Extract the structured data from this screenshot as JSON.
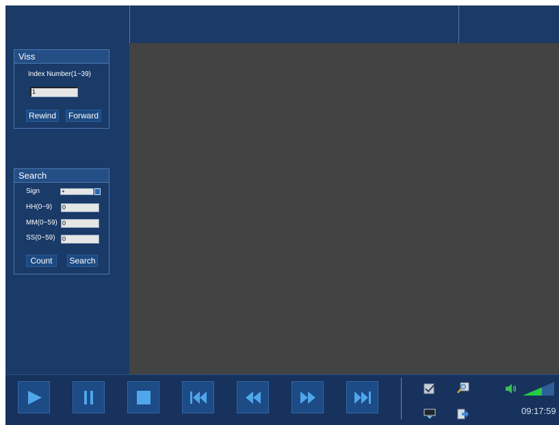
{
  "viss": {
    "title": "Viss",
    "index_label": "Index Number(1~39)",
    "index_value": "1",
    "rewind_label": "Rewind",
    "forward_label": "Forward"
  },
  "search": {
    "title": "Search",
    "sign_label": "Sign",
    "sign_value": "+",
    "hh_label": "HH(0~9)",
    "hh_value": "0",
    "mm_label": "MM(0~59)",
    "mm_value": "0",
    "ss_label": "SS(0~59)",
    "ss_value": "0",
    "count_label": "Count",
    "search_label": "Search"
  },
  "controls": [
    "play-icon",
    "pause-icon",
    "stop-icon",
    "skip-to-start-icon",
    "rewind-icon",
    "fast-forward-icon",
    "skip-to-end-icon"
  ],
  "system_icons": [
    "checklist-icon",
    "zoom-icon",
    "monitor-download-icon",
    "export-icon",
    "volume-icon",
    "signal-strength-icon"
  ],
  "clock": "09:17:59",
  "colors": {
    "panel": "#1a3a68",
    "video_bg": "#434343",
    "accent": "#2c6bb3",
    "signal": "#22cc44"
  }
}
